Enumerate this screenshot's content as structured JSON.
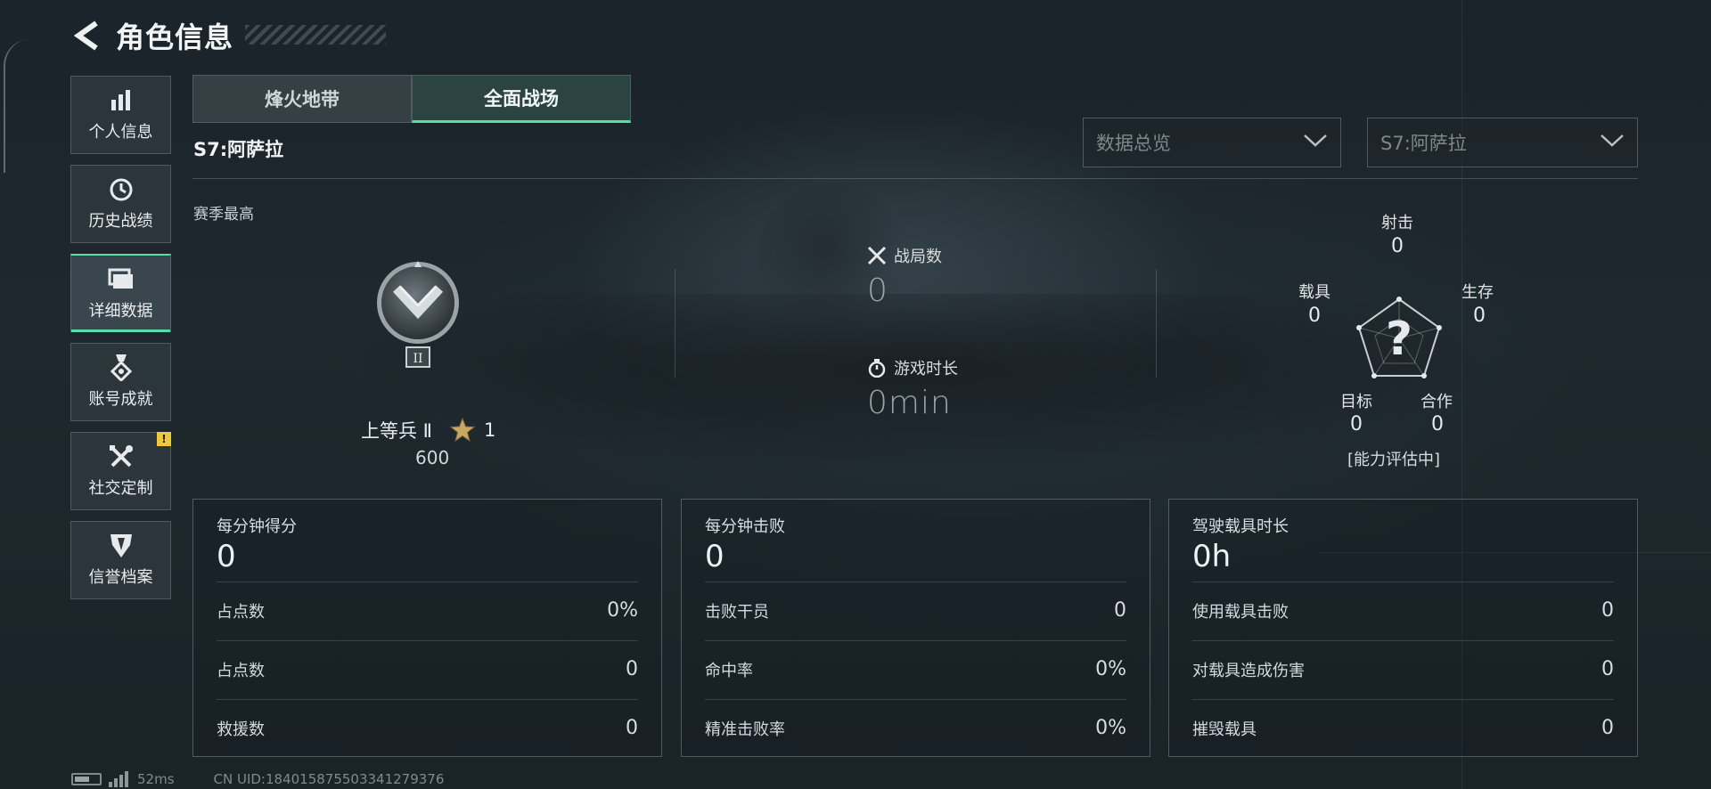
{
  "header": {
    "title": "角色信息",
    "back_icon": "back-arrow-icon"
  },
  "sidebar": {
    "items": [
      {
        "label": "个人信息",
        "icon": "bar-chart-icon"
      },
      {
        "label": "历史战绩",
        "icon": "history-clock-icon"
      },
      {
        "label": "详细数据",
        "icon": "folder-icon",
        "active": true
      },
      {
        "label": "账号成就",
        "icon": "medal-icon"
      },
      {
        "label": "社交定制",
        "icon": "tools-icon",
        "badge": "!"
      },
      {
        "label": "信誉档案",
        "icon": "shield-icon"
      }
    ]
  },
  "tabs": [
    {
      "label": "烽火地带"
    },
    {
      "label": "全面战场",
      "active": true
    }
  ],
  "season": {
    "title": "S7:阿萨拉",
    "best_label": "赛季最高"
  },
  "dropdowns": {
    "view": {
      "value": "数据总览"
    },
    "season": {
      "value": "S7:阿萨拉"
    }
  },
  "rank": {
    "name": "上等兵 Ⅱ",
    "stars": "1",
    "points": "600",
    "badge_numeral": "II"
  },
  "stats": {
    "matches_label": "战局数",
    "matches_value": "0",
    "playtime_label": "游戏时长",
    "playtime_value": "0min"
  },
  "radar": {
    "shooting": {
      "label": "射击",
      "value": "0"
    },
    "survival": {
      "label": "生存",
      "value": "0"
    },
    "cooperation": {
      "label": "合作",
      "value": "0"
    },
    "objective": {
      "label": "目标",
      "value": "0"
    },
    "vehicle": {
      "label": "载具",
      "value": "0"
    },
    "center_mark": "?",
    "status": "[能力评估中]"
  },
  "cards": [
    {
      "title": "每分钟得分",
      "value": "0",
      "rows": [
        {
          "label": "占点数",
          "value": "0%"
        },
        {
          "label": "占点数",
          "value": "0"
        },
        {
          "label": "救援数",
          "value": "0"
        }
      ]
    },
    {
      "title": "每分钟击败",
      "value": "0",
      "rows": [
        {
          "label": "击败干员",
          "value": "0"
        },
        {
          "label": "命中率",
          "value": "0%"
        },
        {
          "label": "精准击败率",
          "value": "0%"
        }
      ]
    },
    {
      "title": "驾驶载具时长",
      "value": "0h",
      "rows": [
        {
          "label": "使用载具击败",
          "value": "0"
        },
        {
          "label": "对载具造成伤害",
          "value": "0"
        },
        {
          "label": "摧毁载具",
          "value": "0"
        }
      ]
    }
  ],
  "footer": {
    "ping": "52ms",
    "uid": "CN UID:18401587550334127937​6"
  }
}
